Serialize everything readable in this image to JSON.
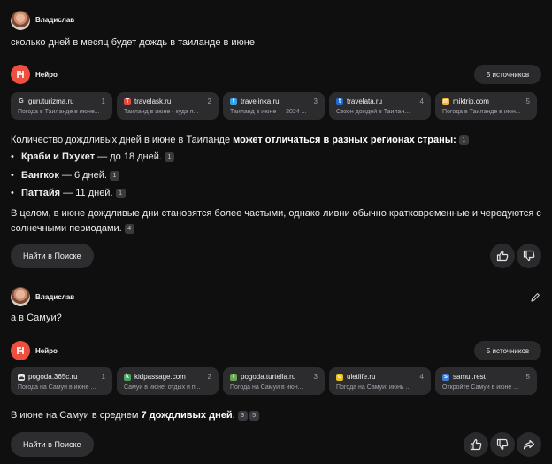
{
  "messages": [
    {
      "user": {
        "name": "Владислав",
        "text": "сколько дней в месяц будет дождь в таиланде в июне"
      },
      "assistant": {
        "name": "Нейро",
        "sources_label": "5 источников",
        "sources": [
          {
            "domain": "guruturizma.ru",
            "num": "1",
            "snippet": "Погода в Таиланде в июне...",
            "icon": "g-letter-icon",
            "icon_color": "#2c2c2f",
            "glyph": "G"
          },
          {
            "domain": "travelask.ru",
            "num": "2",
            "snippet": "Таиланд в июне - куда п...",
            "icon": "travelask-icon",
            "icon_color": "#e9493d",
            "glyph": "T"
          },
          {
            "domain": "travelinka.ru",
            "num": "3",
            "snippet": "Таиланд в июне — 2024 ...",
            "icon": "travelinka-icon",
            "icon_color": "#3aa0e6",
            "glyph": "t"
          },
          {
            "domain": "travelata.ru",
            "num": "4",
            "snippet": "Сезон дождей в Таилан...",
            "icon": "travelata-icon",
            "icon_color": "#1e6ad8",
            "glyph": "t"
          },
          {
            "domain": "miktrip.com",
            "num": "5",
            "snippet": "Погода в Таиланде в июн...",
            "icon": "miktrip-icon",
            "icon_color": "#f0b43a",
            "glyph": "m"
          }
        ],
        "answer": {
          "intro_plain": "Количество дождливых дней в июне в Таиланде ",
          "intro_bold": "может отличаться в разных регионах страны:",
          "intro_ref": "1",
          "bullets": [
            {
              "bold": "Краби и Пхукет",
              "rest": " — до 18 дней.",
              "ref": "1"
            },
            {
              "bold": "Бангкок",
              "rest": " — 6 дней.",
              "ref": "1"
            },
            {
              "bold": "Паттайя",
              "rest": " — 11 дней.",
              "ref": "1"
            }
          ],
          "conclusion": "В целом, в июне дождливые дни становятся более частыми, однако ливни обычно кратковременные и чередуются с солнечными периодами.",
          "conclusion_ref": "4"
        },
        "find_label": "Найти в Поиске"
      }
    },
    {
      "user": {
        "name": "Владислав",
        "text": "а в Самуи?"
      },
      "assistant": {
        "name": "Нейро",
        "sources_label": "5 источников",
        "sources": [
          {
            "domain": "pogoda.365c.ru",
            "num": "1",
            "snippet": "Погода на Самуи в июне ...",
            "icon": "pogoda365-icon",
            "icon_color": "#e6e6e6",
            "glyph": "☁"
          },
          {
            "domain": "kidpassage.com",
            "num": "2",
            "snippet": "Самуи в июне: отдых и п...",
            "icon": "kidpassage-icon",
            "icon_color": "#48a85a",
            "glyph": "k"
          },
          {
            "domain": "pogoda.turtella.ru",
            "num": "3",
            "snippet": "Погода на Самуи в июн...",
            "icon": "turtella-icon",
            "icon_color": "#6aa84f",
            "glyph": "t"
          },
          {
            "domain": "uletlife.ru",
            "num": "4",
            "snippet": "Погода на Самуи: июнь ...",
            "icon": "uletlife-icon",
            "icon_color": "#e8c31e",
            "glyph": "u"
          },
          {
            "domain": "samui.rest",
            "num": "5",
            "snippet": "Откройте Самуи в июне ...",
            "icon": "samui-rest-icon",
            "icon_color": "#3f7fd6",
            "glyph": "s"
          }
        ],
        "answer": {
          "plain": "В июне на Самуи в среднем ",
          "bold": "7 дождливых дней",
          "end": ".",
          "refs": [
            "3",
            "5"
          ]
        },
        "find_label": "Найти в Поиске"
      }
    }
  ]
}
